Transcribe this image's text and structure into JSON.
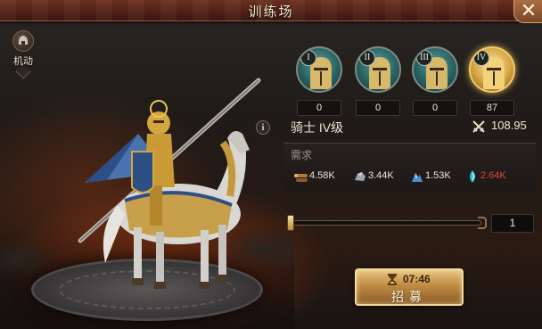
{
  "header": {
    "title": "训练场",
    "close_icon": "close-icon"
  },
  "badge": {
    "label": "机动",
    "icon": "helmet-icon"
  },
  "tiers": [
    {
      "roman": "I",
      "count": "0",
      "selected": false
    },
    {
      "roman": "II",
      "count": "0",
      "selected": false
    },
    {
      "roman": "III",
      "count": "0",
      "selected": false
    },
    {
      "roman": "IV",
      "count": "87",
      "selected": true
    }
  ],
  "unit": {
    "name": "骑士 IV级",
    "power_icon": "crossed-swords-icon",
    "power": "108.95"
  },
  "requirements": {
    "label": "需求",
    "resources": [
      {
        "icon": "wood-icon",
        "value": "4.58K",
        "short": false
      },
      {
        "icon": "stone-icon",
        "value": "3.44K",
        "short": false
      },
      {
        "icon": "ore-icon",
        "value": "1.53K",
        "short": false
      },
      {
        "icon": "mana-icon",
        "value": "2.64K",
        "short": true
      }
    ]
  },
  "quantity": {
    "value": "1",
    "fill_fraction": 0.0
  },
  "recruit": {
    "time": "07:46",
    "label": "招募"
  },
  "colors": {
    "accent_gold": "#f1cc6a",
    "shortage_red": "#e2463f",
    "tier_teal": "#2a6262"
  }
}
